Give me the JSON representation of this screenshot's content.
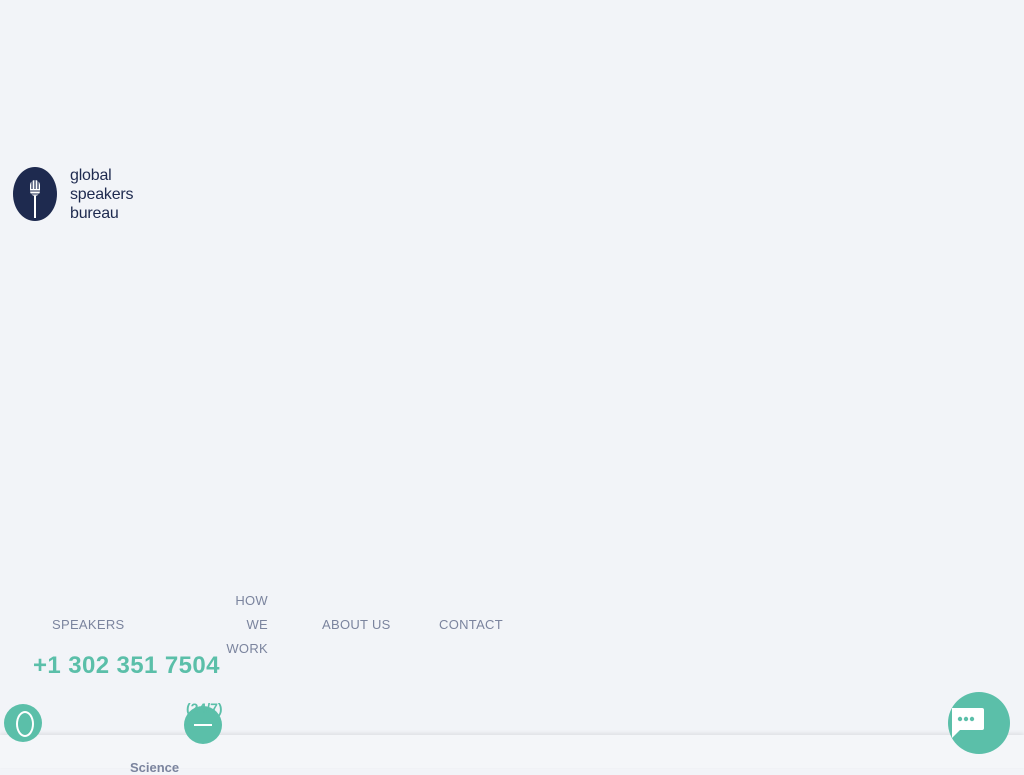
{
  "brand": {
    "line1": "global",
    "line2": "speakers",
    "line3": "bureau",
    "logo_icon": "microphone-icon",
    "color": "#1e2a4f"
  },
  "nav": {
    "speakers": "SPEAKERS",
    "how_we_work_line1": "HOW WE",
    "how_we_work_line2": "WORK",
    "about_us": "ABOUT US",
    "contact": "CONTACT"
  },
  "contact": {
    "phone": "+1 302 351 7504",
    "hours": "(24/7)"
  },
  "footer": {
    "category": "Science"
  },
  "chat": {
    "icon": "chat-bubble-icon"
  },
  "colors": {
    "accent": "#5bbfa9",
    "nav_text": "#7b849e",
    "background": "#f2f4f8"
  }
}
